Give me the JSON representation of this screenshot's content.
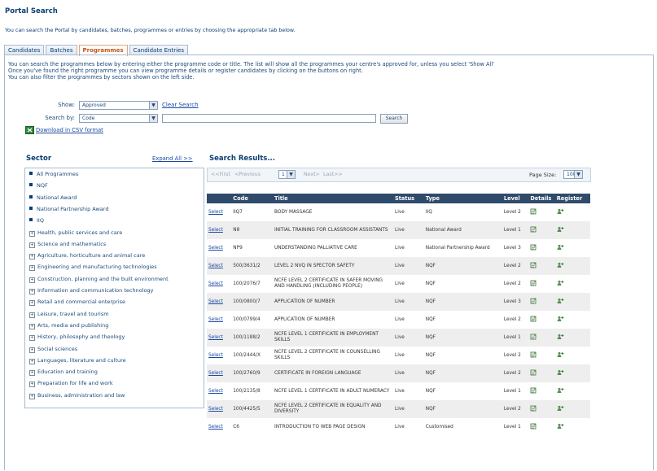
{
  "page": {
    "title": "Portal Search",
    "intro": "You can search the Portal by candidates, batches, programmes or entries by choosing the appropriate tab below."
  },
  "tabs": [
    {
      "label": "Candidates"
    },
    {
      "label": "Batches"
    },
    {
      "label": "Programmes"
    },
    {
      "label": "Candidate Entries"
    }
  ],
  "description": {
    "line1": "You can search the programmes below by entering either the programme code or title. The list will show all the programmes your centre's approved for, unless you select 'Show All'",
    "line2": "Once you've found the right programme you can view programme details or register candidates by clicking on the buttons on right.",
    "line3": "You can also filter the programmes by sectors shown on the left side."
  },
  "form": {
    "show_label": "Show:",
    "show_value": "Approved",
    "clear_search": "Clear Search",
    "search_by_label": "Search by:",
    "search_by_value": "Code",
    "search_text": "",
    "search_button": "Search",
    "download_csv": "Download in CSV format"
  },
  "sector": {
    "heading": "Sector",
    "expand_all": "Expand All >>",
    "items": [
      {
        "label": "All Programmes",
        "type": "bullet"
      },
      {
        "label": "NQF",
        "type": "bullet"
      },
      {
        "label": "National Award",
        "type": "bullet"
      },
      {
        "label": "National Partnership Award",
        "type": "bullet"
      },
      {
        "label": "IIQ",
        "type": "bullet"
      },
      {
        "label": "Health, public services and care",
        "type": "expand"
      },
      {
        "label": "Science and mathematics",
        "type": "expand"
      },
      {
        "label": "Agriculture, horticulture and animal care",
        "type": "expand"
      },
      {
        "label": "Engineering and manufacturing technologies",
        "type": "expand"
      },
      {
        "label": "Construction, planning and the built environment",
        "type": "expand"
      },
      {
        "label": "Information and communication technology",
        "type": "expand"
      },
      {
        "label": "Retail and commercial enterprise",
        "type": "expand"
      },
      {
        "label": "Leisure, travel and tourism",
        "type": "expand"
      },
      {
        "label": "Arts, media and publishing",
        "type": "expand"
      },
      {
        "label": "History, philosophy and theology",
        "type": "expand"
      },
      {
        "label": "Social sciences",
        "type": "expand"
      },
      {
        "label": "Languages, literature and culture",
        "type": "expand"
      },
      {
        "label": "Education and training",
        "type": "expand"
      },
      {
        "label": "Preparation for life and work",
        "type": "expand"
      },
      {
        "label": "Business, administration and law",
        "type": "expand"
      }
    ]
  },
  "results": {
    "heading": "Search Results...",
    "pager": {
      "first": "<<First",
      "previous": "<Previous",
      "page": "1",
      "next": "Next>",
      "last": "Last>>",
      "page_size_label": "Page Size:",
      "page_size": "100"
    },
    "columns": [
      "Code",
      "Title",
      "Status",
      "Type",
      "Level",
      "Details",
      "Register"
    ],
    "select_label": "Select",
    "rows": [
      {
        "code": "IIQ7",
        "title": "BODY MASSAGE",
        "status": "Live",
        "type": "IIQ",
        "level": "Level 2"
      },
      {
        "code": "N8",
        "title": "INITIAL TRAINING FOR CLASSROOM ASSISTANTS",
        "status": "Live",
        "type": "National Award",
        "level": "Level 1"
      },
      {
        "code": "NP9",
        "title": "UNDERSTANDING PALLIATIVE CARE",
        "status": "Live",
        "type": "National Partnership Award",
        "level": "Level 3"
      },
      {
        "code": "500/3631/2",
        "title": "LEVEL 2 NVQ IN SPECTOR SAFETY",
        "status": "Live",
        "type": "NQF",
        "level": "Level 2"
      },
      {
        "code": "100/2076/7",
        "title": "NCFE LEVEL 2 CERTIFICATE IN SAFER MOVING AND HANDLING (INCLUDING PEOPLE)",
        "status": "Live",
        "type": "NQF",
        "level": "Level 2"
      },
      {
        "code": "100/0800/7",
        "title": "APPLICATION OF NUMBER",
        "status": "Live",
        "type": "NQF",
        "level": "Level 3"
      },
      {
        "code": "100/0799/4",
        "title": "APPLICATION OF NUMBER",
        "status": "Live",
        "type": "NQF",
        "level": "Level 2"
      },
      {
        "code": "100/1188/2",
        "title": "NCFE LEVEL 1 CERTIFICATE IN EMPLOYMENT SKILLS",
        "status": "Live",
        "type": "NQF",
        "level": "Level 1"
      },
      {
        "code": "100/2444/X",
        "title": "NCFE LEVEL 2 CERTIFICATE IN COUNSELLING SKILLS",
        "status": "Live",
        "type": "NQF",
        "level": "Level 2"
      },
      {
        "code": "100/2760/9",
        "title": "CERTIFICATE IN FOREIGN LANGUAGE",
        "status": "Live",
        "type": "NQF",
        "level": "Level 2"
      },
      {
        "code": "100/2135/8",
        "title": "NCFE LEVEL 1 CERTIFICATE IN ADULT NUMERACY",
        "status": "Live",
        "type": "NQF",
        "level": "Level 1"
      },
      {
        "code": "100/4425/5",
        "title": "NCFE LEVEL 2 CERTIFICATE IN EQUALITY AND DIVERSITY",
        "status": "Live",
        "type": "NQF",
        "level": "Level 2"
      },
      {
        "code": "C6",
        "title": "INTRODUCTION TO WEB PAGE DESIGN",
        "status": "Live",
        "type": "Customised",
        "level": "Level 1"
      }
    ]
  },
  "colors": {
    "heading": "#0b3e73",
    "table_header": "#2f4b6b",
    "active_tab": "#c4561a",
    "row_alt": "#eeeeee"
  }
}
